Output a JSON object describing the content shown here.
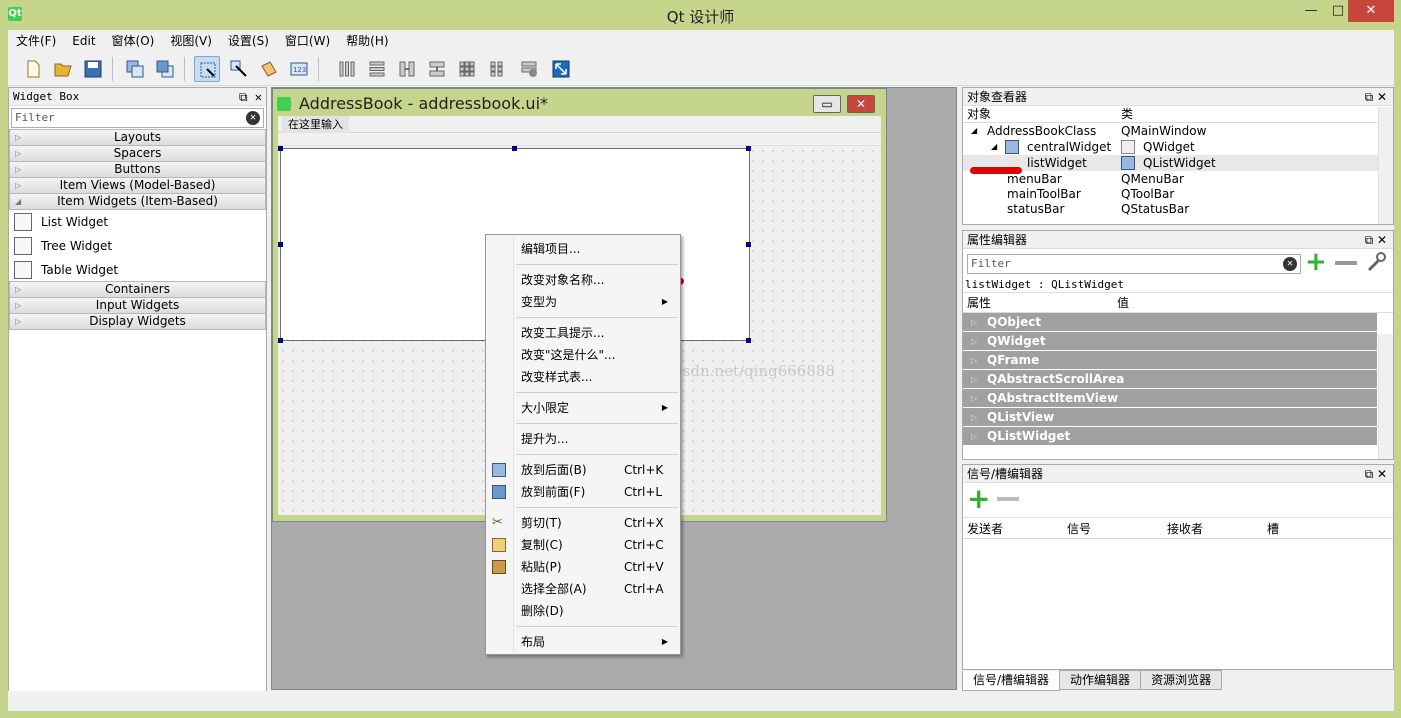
{
  "window": {
    "title": "Qt 设计师",
    "app_icon": "Qt",
    "minimize": "—",
    "maximize": "□",
    "close": "✕"
  },
  "menu": [
    "文件(F)",
    "Edit",
    "窗体(O)",
    "视图(V)",
    "设置(S)",
    "窗口(W)",
    "帮助(H)"
  ],
  "widget_box": {
    "title": "Widget Box",
    "dock_buttons": "⧉ ✕",
    "filter_placeholder": "Filter",
    "categories_top": [
      "Layouts",
      "Spacers",
      "Buttons",
      "Item Views (Model-Based)"
    ],
    "expanded_category": "Item Widgets (Item-Based)",
    "items": [
      "List Widget",
      "Tree Widget",
      "Table Widget"
    ],
    "categories_bottom": [
      "Containers",
      "Input Widgets",
      "Display Widgets"
    ]
  },
  "subwindow": {
    "title": "AddressBook - addressbook.ui*",
    "menu_placeholder": "在这里输入",
    "min_button": "▭",
    "close_button": "✕"
  },
  "context_menu": {
    "items": [
      {
        "label": "编辑项目...",
        "shortcut": ""
      },
      {
        "label": "改变对象名称...",
        "shortcut": ""
      },
      {
        "label": "变型为",
        "shortcut": ""
      },
      {
        "label": "改变工具提示...",
        "shortcut": ""
      },
      {
        "label": "改变\"这是什么\"...",
        "shortcut": ""
      },
      {
        "label": "改变样式表...",
        "shortcut": ""
      },
      {
        "label": "大小限定",
        "shortcut": ""
      },
      {
        "label": "提升为...",
        "shortcut": ""
      },
      {
        "label": "放到后面(B)",
        "shortcut": "Ctrl+K"
      },
      {
        "label": "放到前面(F)",
        "shortcut": "Ctrl+L"
      },
      {
        "label": "剪切(T)",
        "shortcut": "Ctrl+X"
      },
      {
        "label": "复制(C)",
        "shortcut": "Ctrl+C"
      },
      {
        "label": "粘贴(P)",
        "shortcut": "Ctrl+V"
      },
      {
        "label": "选择全部(A)",
        "shortcut": "Ctrl+A"
      },
      {
        "label": "删除(D)",
        "shortcut": ""
      },
      {
        "label": "布局",
        "shortcut": ""
      }
    ],
    "submenu_arrow": "▶"
  },
  "watermark": "http://blog.csdn.net/qing666888",
  "object_inspector": {
    "title": "对象查看器",
    "dock_buttons": "⧉ ✕",
    "col_object": "对象",
    "col_class": "类",
    "rows": [
      {
        "object": "AddressBookClass",
        "class": "QMainWindow"
      },
      {
        "object": "centralWidget",
        "class": "QWidget"
      },
      {
        "object": "listWidget",
        "class": "QListWidget"
      },
      {
        "object": "menuBar",
        "class": "QMenuBar"
      },
      {
        "object": "mainToolBar",
        "class": "QToolBar"
      },
      {
        "object": "statusBar",
        "class": "QStatusBar"
      }
    ]
  },
  "property_editor": {
    "title": "属性编辑器",
    "dock_buttons": "⧉ ✕",
    "filter_placeholder": "Filter",
    "object_label": "listWidget : QListWidget",
    "col_property": "属性",
    "col_value": "值",
    "groups": [
      "QObject",
      "QWidget",
      "QFrame",
      "QAbstractScrollArea",
      "QAbstractItemView",
      "QListView",
      "QListWidget"
    ]
  },
  "signal_slot_editor": {
    "title": "信号/槽编辑器",
    "dock_buttons": "⧉ ✕",
    "columns": [
      "发送者",
      "信号",
      "接收者",
      "槽"
    ]
  },
  "bottom_tabs": [
    "信号/槽编辑器",
    "动作编辑器",
    "资源浏览器"
  ],
  "colors": {
    "titlebar": "#c5d58c",
    "close": "#c7463c",
    "property_group": "#a0a0a0",
    "handle": "#000080",
    "red_mark": "#e30000"
  }
}
